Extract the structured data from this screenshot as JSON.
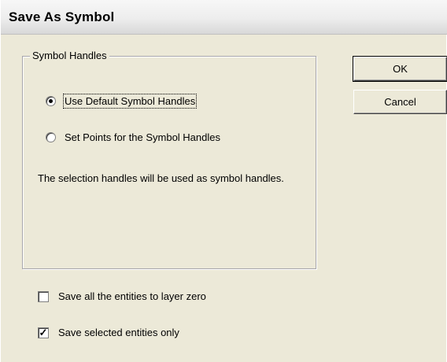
{
  "window": {
    "title": "Save As Symbol"
  },
  "symbol_handles": {
    "group_label": "Symbol Handles",
    "options": [
      {
        "label": "Use Default Symbol Handles",
        "selected": true
      },
      {
        "label": "Set Points for the Symbol Handles",
        "selected": false
      }
    ],
    "description": "The selection handles will be used as symbol handles."
  },
  "options": {
    "save_layer_zero": {
      "label": "Save all the entities to layer zero",
      "checked": false
    },
    "save_selected_only": {
      "label": "Save selected entities only",
      "checked": true
    }
  },
  "buttons": {
    "ok": "OK",
    "cancel": "Cancel"
  }
}
